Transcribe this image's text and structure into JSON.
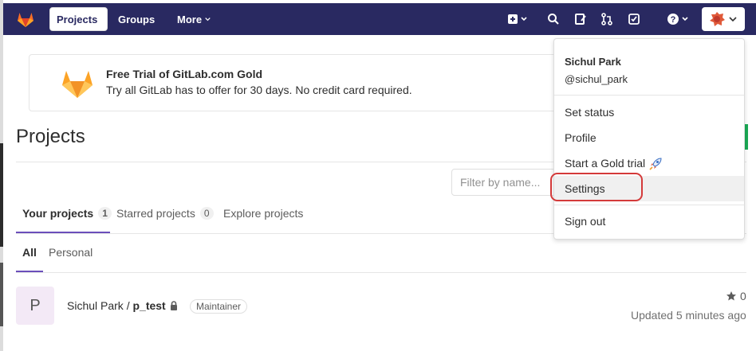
{
  "navbar": {
    "projects_label": "Projects",
    "groups_label": "Groups",
    "more_label": "More",
    "icons": [
      "plus-icon",
      "search-icon",
      "issues-icon",
      "merge-request-icon",
      "todo-icon",
      "help-icon"
    ]
  },
  "banner": {
    "title": "Free Trial of GitLab.com Gold",
    "text": "Try all GitLab has to offer for 30 days. No credit card required."
  },
  "page": {
    "title": "Projects",
    "filter_placeholder": "Filter by name..."
  },
  "tabs": [
    {
      "label": "Your projects",
      "count": "1",
      "active": true
    },
    {
      "label": "Starred projects",
      "count": "0",
      "active": false
    },
    {
      "label": "Explore projects",
      "active": false
    }
  ],
  "subtabs": [
    {
      "label": "All",
      "active": true
    },
    {
      "label": "Personal",
      "active": false
    }
  ],
  "project": {
    "avatar_letter": "P",
    "namespace": "Sichul Park / ",
    "name": "p_test",
    "role": "Maintainer",
    "stars": "0",
    "updated": "Updated 5 minutes ago"
  },
  "user_menu": {
    "name": "Sichul Park",
    "handle": "@sichul_park",
    "items": [
      "Set status",
      "Profile",
      "Start a Gold trial",
      "Settings",
      "Sign out"
    ]
  },
  "colors": {
    "navbar": "#292961",
    "accent": "#6b4fbb",
    "highlight_ring": "#d43a3a"
  }
}
